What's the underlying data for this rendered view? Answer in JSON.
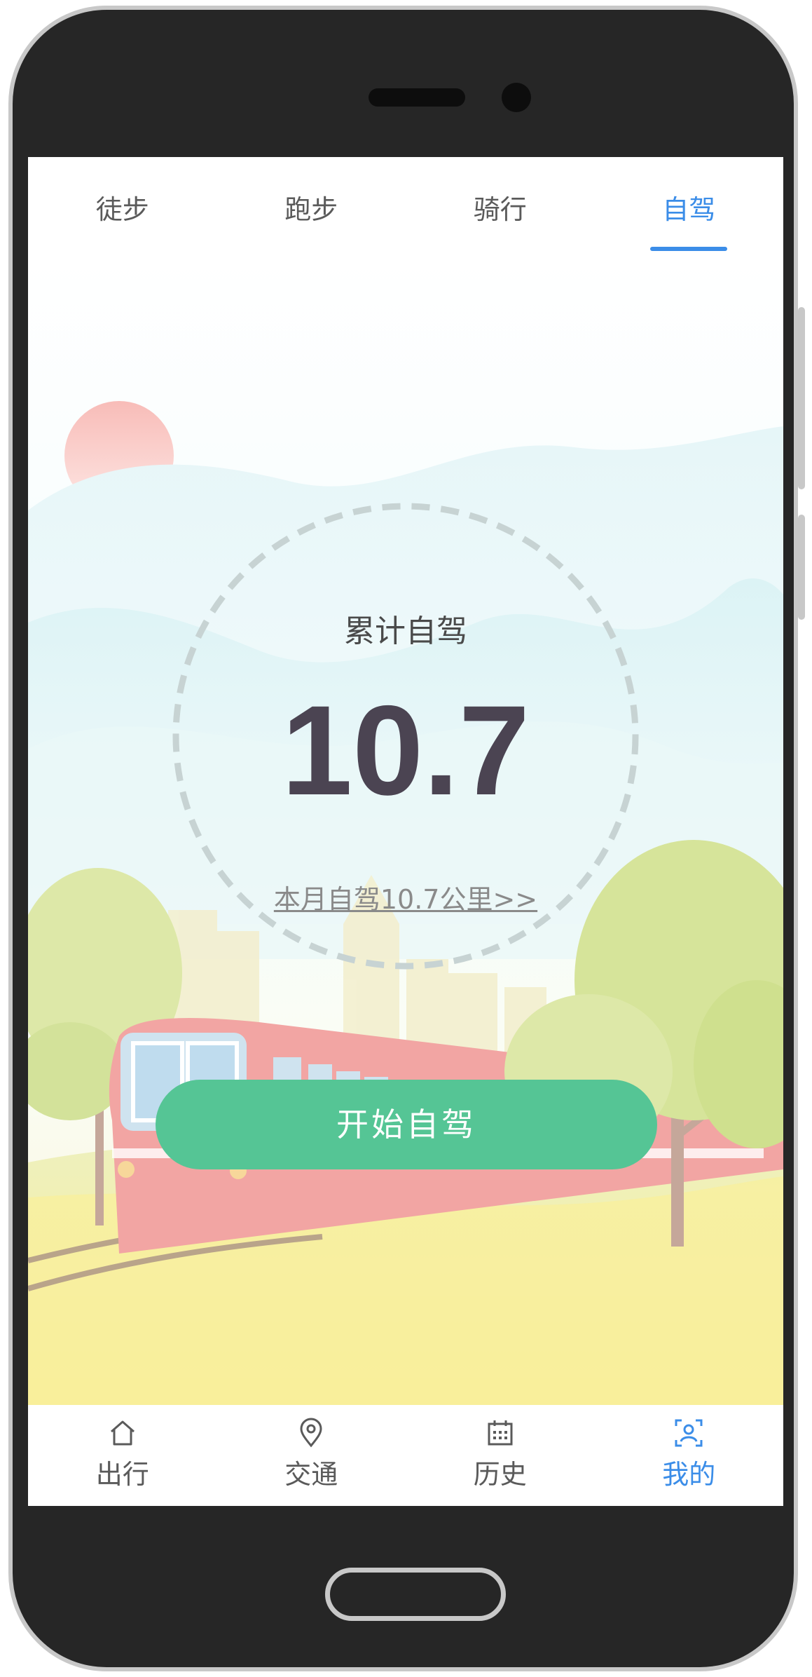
{
  "tabs": [
    {
      "label": "徒步"
    },
    {
      "label": "跑步"
    },
    {
      "label": "骑行"
    },
    {
      "label": "自驾"
    }
  ],
  "active_tab": "自驾",
  "summary": {
    "label": "累计自驾",
    "value": "10.7",
    "month_link": "本月自驾10.7公里>>"
  },
  "start_button": "开始自驾",
  "bottom_nav": [
    {
      "label": "出行",
      "icon": "home-icon"
    },
    {
      "label": "交通",
      "icon": "location-pin-icon"
    },
    {
      "label": "历史",
      "icon": "calendar-icon"
    },
    {
      "label": "我的",
      "icon": "user-scan-icon"
    }
  ],
  "active_nav": "我的",
  "colors": {
    "accent": "#3b8de8",
    "start_button": "#55c595",
    "value_text": "#4b4452"
  }
}
